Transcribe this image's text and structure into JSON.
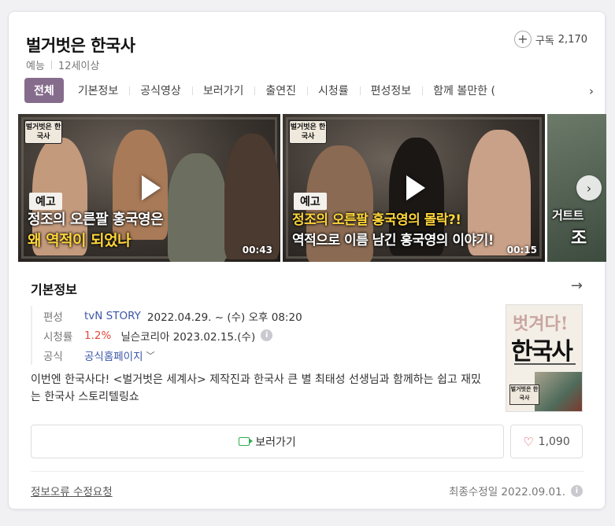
{
  "header": {
    "title": "벌거벗은 한국사",
    "subscribe_label": "구독",
    "subscribe_count": "2,170",
    "genre": "예능",
    "rating": "12세이상"
  },
  "tabs": [
    "전체",
    "기본정보",
    "공식영상",
    "보러가기",
    "출연진",
    "시청률",
    "편성정보",
    "함께 볼만한 ("
  ],
  "videos": [
    {
      "badge": "벌거벗은 한국사",
      "tag": "예고",
      "line1": "정조의 오른팔 홍국영은",
      "line2": "왜 역적이 되었나",
      "duration": "00:43"
    },
    {
      "badge": "벌거벗은 한국사",
      "tag": "예고",
      "line1": "정조의 오른팔 홍국영의 몰락?!",
      "line2": "역적으로 이름 남긴 홍국영의 이야기!",
      "duration": "00:15"
    },
    {
      "line1": "거트트",
      "line2": "조"
    }
  ],
  "info": {
    "heading": "기본정보",
    "schedule_label": "편성",
    "channel": "tvN STORY",
    "schedule": "2022.04.29. ~ (수) 오후 08:20",
    "rating_label": "시청률",
    "rating_value": "1.2%",
    "rating_source": "닐슨코리아 2023.02.15.(수)",
    "official_label": "공식",
    "official_link": "공식홈페이지",
    "description": "이번엔 한국사다! <벌거벗은 세계사> 제작진과 한국사 큰 별 최태성 선생님과 함께하는 쉽고 재밌는 한국사 스토리텔링쇼"
  },
  "poster": {
    "top": "벗겨다!",
    "main": "한국사",
    "badge": "벌거벗은 한국사"
  },
  "actions": {
    "watch_label": "보러가기",
    "like_count": "1,090"
  },
  "footer": {
    "report": "정보오류 수정요청",
    "modified": "최종수정일 2022.09.01."
  }
}
